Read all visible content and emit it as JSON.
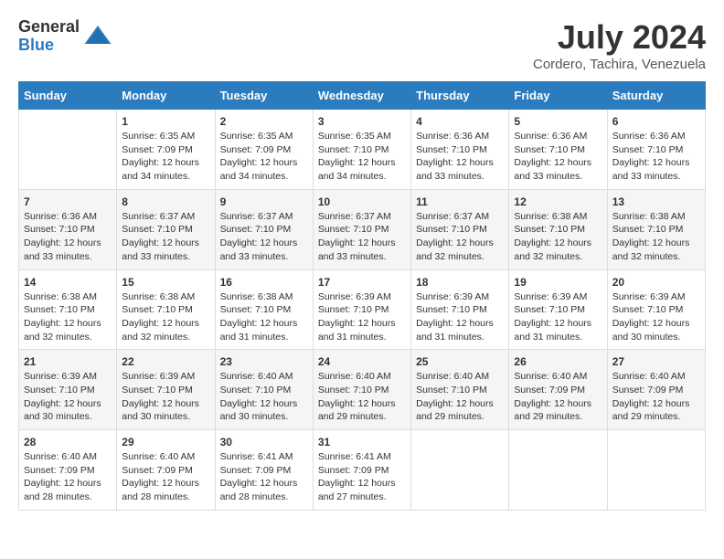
{
  "logo": {
    "general": "General",
    "blue": "Blue"
  },
  "title": {
    "month_year": "July 2024",
    "location": "Cordero, Tachira, Venezuela"
  },
  "days_header": [
    "Sunday",
    "Monday",
    "Tuesday",
    "Wednesday",
    "Thursday",
    "Friday",
    "Saturday"
  ],
  "weeks": [
    [
      {
        "day": "",
        "sunrise": "",
        "sunset": "",
        "daylight": ""
      },
      {
        "day": "1",
        "sunrise": "Sunrise: 6:35 AM",
        "sunset": "Sunset: 7:09 PM",
        "daylight": "Daylight: 12 hours and 34 minutes."
      },
      {
        "day": "2",
        "sunrise": "Sunrise: 6:35 AM",
        "sunset": "Sunset: 7:09 PM",
        "daylight": "Daylight: 12 hours and 34 minutes."
      },
      {
        "day": "3",
        "sunrise": "Sunrise: 6:35 AM",
        "sunset": "Sunset: 7:10 PM",
        "daylight": "Daylight: 12 hours and 34 minutes."
      },
      {
        "day": "4",
        "sunrise": "Sunrise: 6:36 AM",
        "sunset": "Sunset: 7:10 PM",
        "daylight": "Daylight: 12 hours and 33 minutes."
      },
      {
        "day": "5",
        "sunrise": "Sunrise: 6:36 AM",
        "sunset": "Sunset: 7:10 PM",
        "daylight": "Daylight: 12 hours and 33 minutes."
      },
      {
        "day": "6",
        "sunrise": "Sunrise: 6:36 AM",
        "sunset": "Sunset: 7:10 PM",
        "daylight": "Daylight: 12 hours and 33 minutes."
      }
    ],
    [
      {
        "day": "7",
        "sunrise": "Sunrise: 6:36 AM",
        "sunset": "Sunset: 7:10 PM",
        "daylight": "Daylight: 12 hours and 33 minutes."
      },
      {
        "day": "8",
        "sunrise": "Sunrise: 6:37 AM",
        "sunset": "Sunset: 7:10 PM",
        "daylight": "Daylight: 12 hours and 33 minutes."
      },
      {
        "day": "9",
        "sunrise": "Sunrise: 6:37 AM",
        "sunset": "Sunset: 7:10 PM",
        "daylight": "Daylight: 12 hours and 33 minutes."
      },
      {
        "day": "10",
        "sunrise": "Sunrise: 6:37 AM",
        "sunset": "Sunset: 7:10 PM",
        "daylight": "Daylight: 12 hours and 33 minutes."
      },
      {
        "day": "11",
        "sunrise": "Sunrise: 6:37 AM",
        "sunset": "Sunset: 7:10 PM",
        "daylight": "Daylight: 12 hours and 32 minutes."
      },
      {
        "day": "12",
        "sunrise": "Sunrise: 6:38 AM",
        "sunset": "Sunset: 7:10 PM",
        "daylight": "Daylight: 12 hours and 32 minutes."
      },
      {
        "day": "13",
        "sunrise": "Sunrise: 6:38 AM",
        "sunset": "Sunset: 7:10 PM",
        "daylight": "Daylight: 12 hours and 32 minutes."
      }
    ],
    [
      {
        "day": "14",
        "sunrise": "Sunrise: 6:38 AM",
        "sunset": "Sunset: 7:10 PM",
        "daylight": "Daylight: 12 hours and 32 minutes."
      },
      {
        "day": "15",
        "sunrise": "Sunrise: 6:38 AM",
        "sunset": "Sunset: 7:10 PM",
        "daylight": "Daylight: 12 hours and 32 minutes."
      },
      {
        "day": "16",
        "sunrise": "Sunrise: 6:38 AM",
        "sunset": "Sunset: 7:10 PM",
        "daylight": "Daylight: 12 hours and 31 minutes."
      },
      {
        "day": "17",
        "sunrise": "Sunrise: 6:39 AM",
        "sunset": "Sunset: 7:10 PM",
        "daylight": "Daylight: 12 hours and 31 minutes."
      },
      {
        "day": "18",
        "sunrise": "Sunrise: 6:39 AM",
        "sunset": "Sunset: 7:10 PM",
        "daylight": "Daylight: 12 hours and 31 minutes."
      },
      {
        "day": "19",
        "sunrise": "Sunrise: 6:39 AM",
        "sunset": "Sunset: 7:10 PM",
        "daylight": "Daylight: 12 hours and 31 minutes."
      },
      {
        "day": "20",
        "sunrise": "Sunrise: 6:39 AM",
        "sunset": "Sunset: 7:10 PM",
        "daylight": "Daylight: 12 hours and 30 minutes."
      }
    ],
    [
      {
        "day": "21",
        "sunrise": "Sunrise: 6:39 AM",
        "sunset": "Sunset: 7:10 PM",
        "daylight": "Daylight: 12 hours and 30 minutes."
      },
      {
        "day": "22",
        "sunrise": "Sunrise: 6:39 AM",
        "sunset": "Sunset: 7:10 PM",
        "daylight": "Daylight: 12 hours and 30 minutes."
      },
      {
        "day": "23",
        "sunrise": "Sunrise: 6:40 AM",
        "sunset": "Sunset: 7:10 PM",
        "daylight": "Daylight: 12 hours and 30 minutes."
      },
      {
        "day": "24",
        "sunrise": "Sunrise: 6:40 AM",
        "sunset": "Sunset: 7:10 PM",
        "daylight": "Daylight: 12 hours and 29 minutes."
      },
      {
        "day": "25",
        "sunrise": "Sunrise: 6:40 AM",
        "sunset": "Sunset: 7:10 PM",
        "daylight": "Daylight: 12 hours and 29 minutes."
      },
      {
        "day": "26",
        "sunrise": "Sunrise: 6:40 AM",
        "sunset": "Sunset: 7:09 PM",
        "daylight": "Daylight: 12 hours and 29 minutes."
      },
      {
        "day": "27",
        "sunrise": "Sunrise: 6:40 AM",
        "sunset": "Sunset: 7:09 PM",
        "daylight": "Daylight: 12 hours and 29 minutes."
      }
    ],
    [
      {
        "day": "28",
        "sunrise": "Sunrise: 6:40 AM",
        "sunset": "Sunset: 7:09 PM",
        "daylight": "Daylight: 12 hours and 28 minutes."
      },
      {
        "day": "29",
        "sunrise": "Sunrise: 6:40 AM",
        "sunset": "Sunset: 7:09 PM",
        "daylight": "Daylight: 12 hours and 28 minutes."
      },
      {
        "day": "30",
        "sunrise": "Sunrise: 6:41 AM",
        "sunset": "Sunset: 7:09 PM",
        "daylight": "Daylight: 12 hours and 28 minutes."
      },
      {
        "day": "31",
        "sunrise": "Sunrise: 6:41 AM",
        "sunset": "Sunset: 7:09 PM",
        "daylight": "Daylight: 12 hours and 27 minutes."
      },
      {
        "day": "",
        "sunrise": "",
        "sunset": "",
        "daylight": ""
      },
      {
        "day": "",
        "sunrise": "",
        "sunset": "",
        "daylight": ""
      },
      {
        "day": "",
        "sunrise": "",
        "sunset": "",
        "daylight": ""
      }
    ]
  ]
}
